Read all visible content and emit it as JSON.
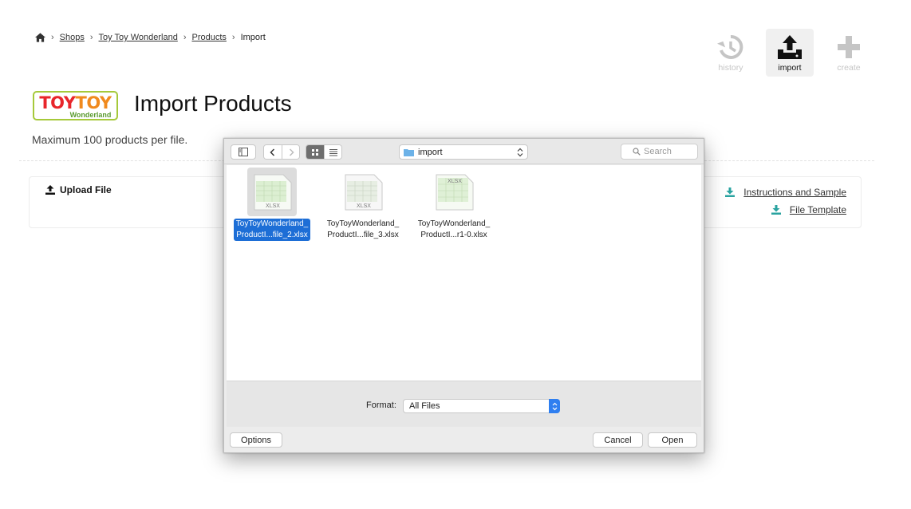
{
  "breadcrumb": {
    "home_icon": "home-icon",
    "items": [
      {
        "label": "Shops"
      },
      {
        "label": "Toy Toy Wonderland"
      },
      {
        "label": "Products"
      },
      {
        "label": "Import"
      }
    ],
    "separator": "›"
  },
  "actions": [
    {
      "label": "history",
      "icon": "history-icon",
      "state": "disabled"
    },
    {
      "label": "import",
      "icon": "upload-tray-icon",
      "state": "active"
    },
    {
      "label": "create",
      "icon": "plus-icon",
      "state": "disabled"
    }
  ],
  "logo": {
    "line1a": "TOY",
    "line1b": "TOY",
    "line2": "Wonderland"
  },
  "page": {
    "title": "Import Products",
    "subtitle": "Maximum 100 products per file."
  },
  "upload": {
    "label": "Upload File",
    "links": [
      {
        "label": "Instructions and Sample",
        "icon": "download-icon"
      },
      {
        "label": "File Template",
        "icon": "download-icon"
      }
    ]
  },
  "dialog": {
    "location": "import",
    "search_placeholder": "Search",
    "files": [
      {
        "name_line1": "ToyToyWonderland_",
        "name_line2": "ProductI...file_2.xlsx",
        "badge": "XLSX",
        "selected": true
      },
      {
        "name_line1": "ToyToyWonderland_",
        "name_line2": "ProductI...file_3.xlsx",
        "badge": "XLSX",
        "selected": false
      },
      {
        "name_line1": "ToyToyWonderland_",
        "name_line2": "ProductI...r1-0.xlsx",
        "badge": "XLSX",
        "selected": false
      }
    ],
    "format_label": "Format:",
    "format_value": "All Files",
    "options_label": "Options",
    "cancel_label": "Cancel",
    "open_label": "Open"
  },
  "colors": {
    "accent": "#1d6ed6",
    "teal_icon": "#2aa3a0",
    "logo_red": "#e8262b",
    "logo_orange": "#f08a1e",
    "logo_green": "#5a9a2e"
  }
}
